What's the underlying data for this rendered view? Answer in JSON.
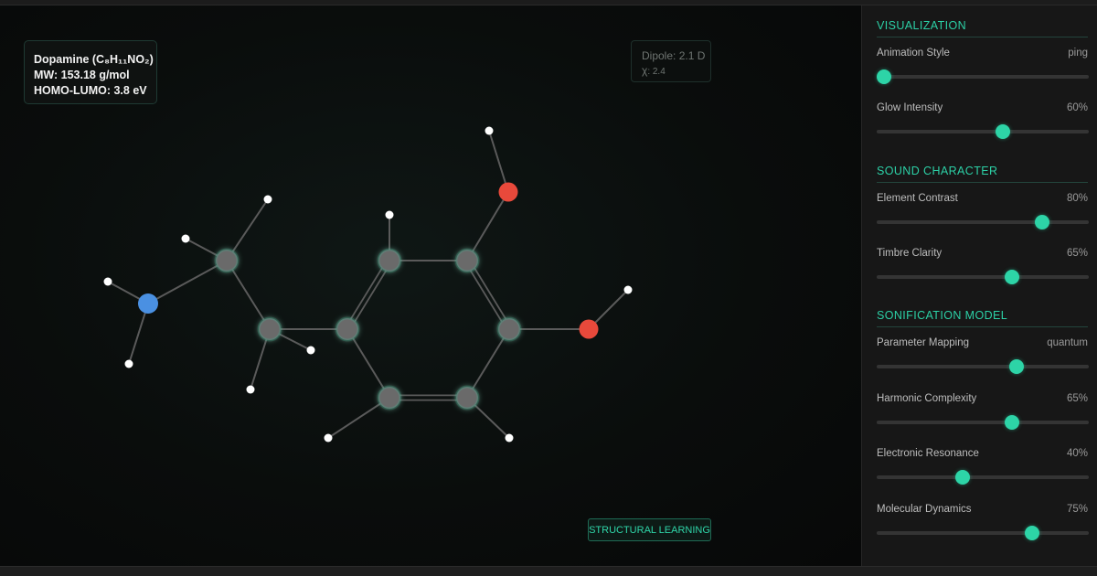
{
  "molecule_info": {
    "name_line": "Dopamine (C₈H₁₁NO₂)",
    "mw_line": "MW: 153.18 g/mol",
    "homo_lumo_line": "HOMO-LUMO: 3.8 eV"
  },
  "molecule_stats": {
    "dipole": "Dipole: 2.1 D",
    "chi_symbol": "χ",
    "chi_value": ": 2.4"
  },
  "learning_button": {
    "label": "STRUCTURAL LEARNING"
  },
  "colors": {
    "accent": "#2dd4a7",
    "carbon": "#6b6b6b",
    "oxygen": "#e8493b",
    "nitrogen": "#4a90e2",
    "hydrogen": "#ffffff",
    "bond": "#5a5a5a"
  },
  "sidebar": {
    "sections": [
      {
        "title": "VISUALIZATION",
        "controls": [
          {
            "label": "Animation Style",
            "value": "ping",
            "level": 0.0
          },
          {
            "label": "Glow Intensity",
            "value": "60%",
            "level": 0.6
          }
        ]
      },
      {
        "title": "SOUND CHARACTER",
        "controls": [
          {
            "label": "Element Contrast",
            "value": "80%",
            "level": 0.8
          },
          {
            "label": "Timbre Clarity",
            "value": "65%",
            "level": 0.65
          }
        ]
      },
      {
        "title": "SONIFICATION MODEL",
        "controls": [
          {
            "label": "Parameter Mapping",
            "value": "quantum",
            "level": 0.67
          },
          {
            "label": "Harmonic Complexity",
            "value": "65%",
            "level": 0.65
          },
          {
            "label": "Electronic Resonance",
            "value": "40%",
            "level": 0.4
          },
          {
            "label": "Molecular Dynamics",
            "value": "75%",
            "level": 0.75
          }
        ]
      }
    ]
  },
  "molecule": {
    "atoms": [
      {
        "element": "N"
      },
      {
        "element": "C"
      },
      {
        "element": "C"
      },
      {
        "element": "C"
      },
      {
        "element": "C"
      },
      {
        "element": "C"
      },
      {
        "element": "C"
      },
      {
        "element": "C"
      },
      {
        "element": "C"
      },
      {
        "element": "O"
      },
      {
        "element": "O"
      },
      {
        "element": "H"
      },
      {
        "element": "H"
      },
      {
        "element": "H"
      },
      {
        "element": "H"
      },
      {
        "element": "H"
      },
      {
        "element": "H"
      },
      {
        "element": "H"
      },
      {
        "element": "H"
      },
      {
        "element": "H"
      },
      {
        "element": "H"
      },
      {
        "element": "H"
      }
    ],
    "bonds": [
      {
        "a": 0,
        "b": 1,
        "order": 1
      },
      {
        "a": 1,
        "b": 2,
        "order": 1
      },
      {
        "a": 2,
        "b": 3,
        "order": 1
      },
      {
        "a": 3,
        "b": 4,
        "order": 2
      },
      {
        "a": 4,
        "b": 5,
        "order": 1
      },
      {
        "a": 5,
        "b": 6,
        "order": 2
      },
      {
        "a": 6,
        "b": 7,
        "order": 1
      },
      {
        "a": 7,
        "b": 8,
        "order": 2
      },
      {
        "a": 8,
        "b": 3,
        "order": 1
      },
      {
        "a": 5,
        "b": 9,
        "order": 1
      },
      {
        "a": 6,
        "b": 10,
        "order": 1
      },
      {
        "a": 0,
        "b": 11,
        "order": 1
      },
      {
        "a": 0,
        "b": 12,
        "order": 1
      },
      {
        "a": 1,
        "b": 13,
        "order": 1
      },
      {
        "a": 1,
        "b": 14,
        "order": 1
      },
      {
        "a": 2,
        "b": 15,
        "order": 1
      },
      {
        "a": 2,
        "b": 16,
        "order": 1
      },
      {
        "a": 4,
        "b": 17,
        "order": 1
      },
      {
        "a": 9,
        "b": 18,
        "order": 1
      },
      {
        "a": 10,
        "b": 19,
        "order": 1
      },
      {
        "a": 7,
        "b": 20,
        "order": 1
      },
      {
        "a": 8,
        "b": 21,
        "order": 1
      }
    ]
  }
}
